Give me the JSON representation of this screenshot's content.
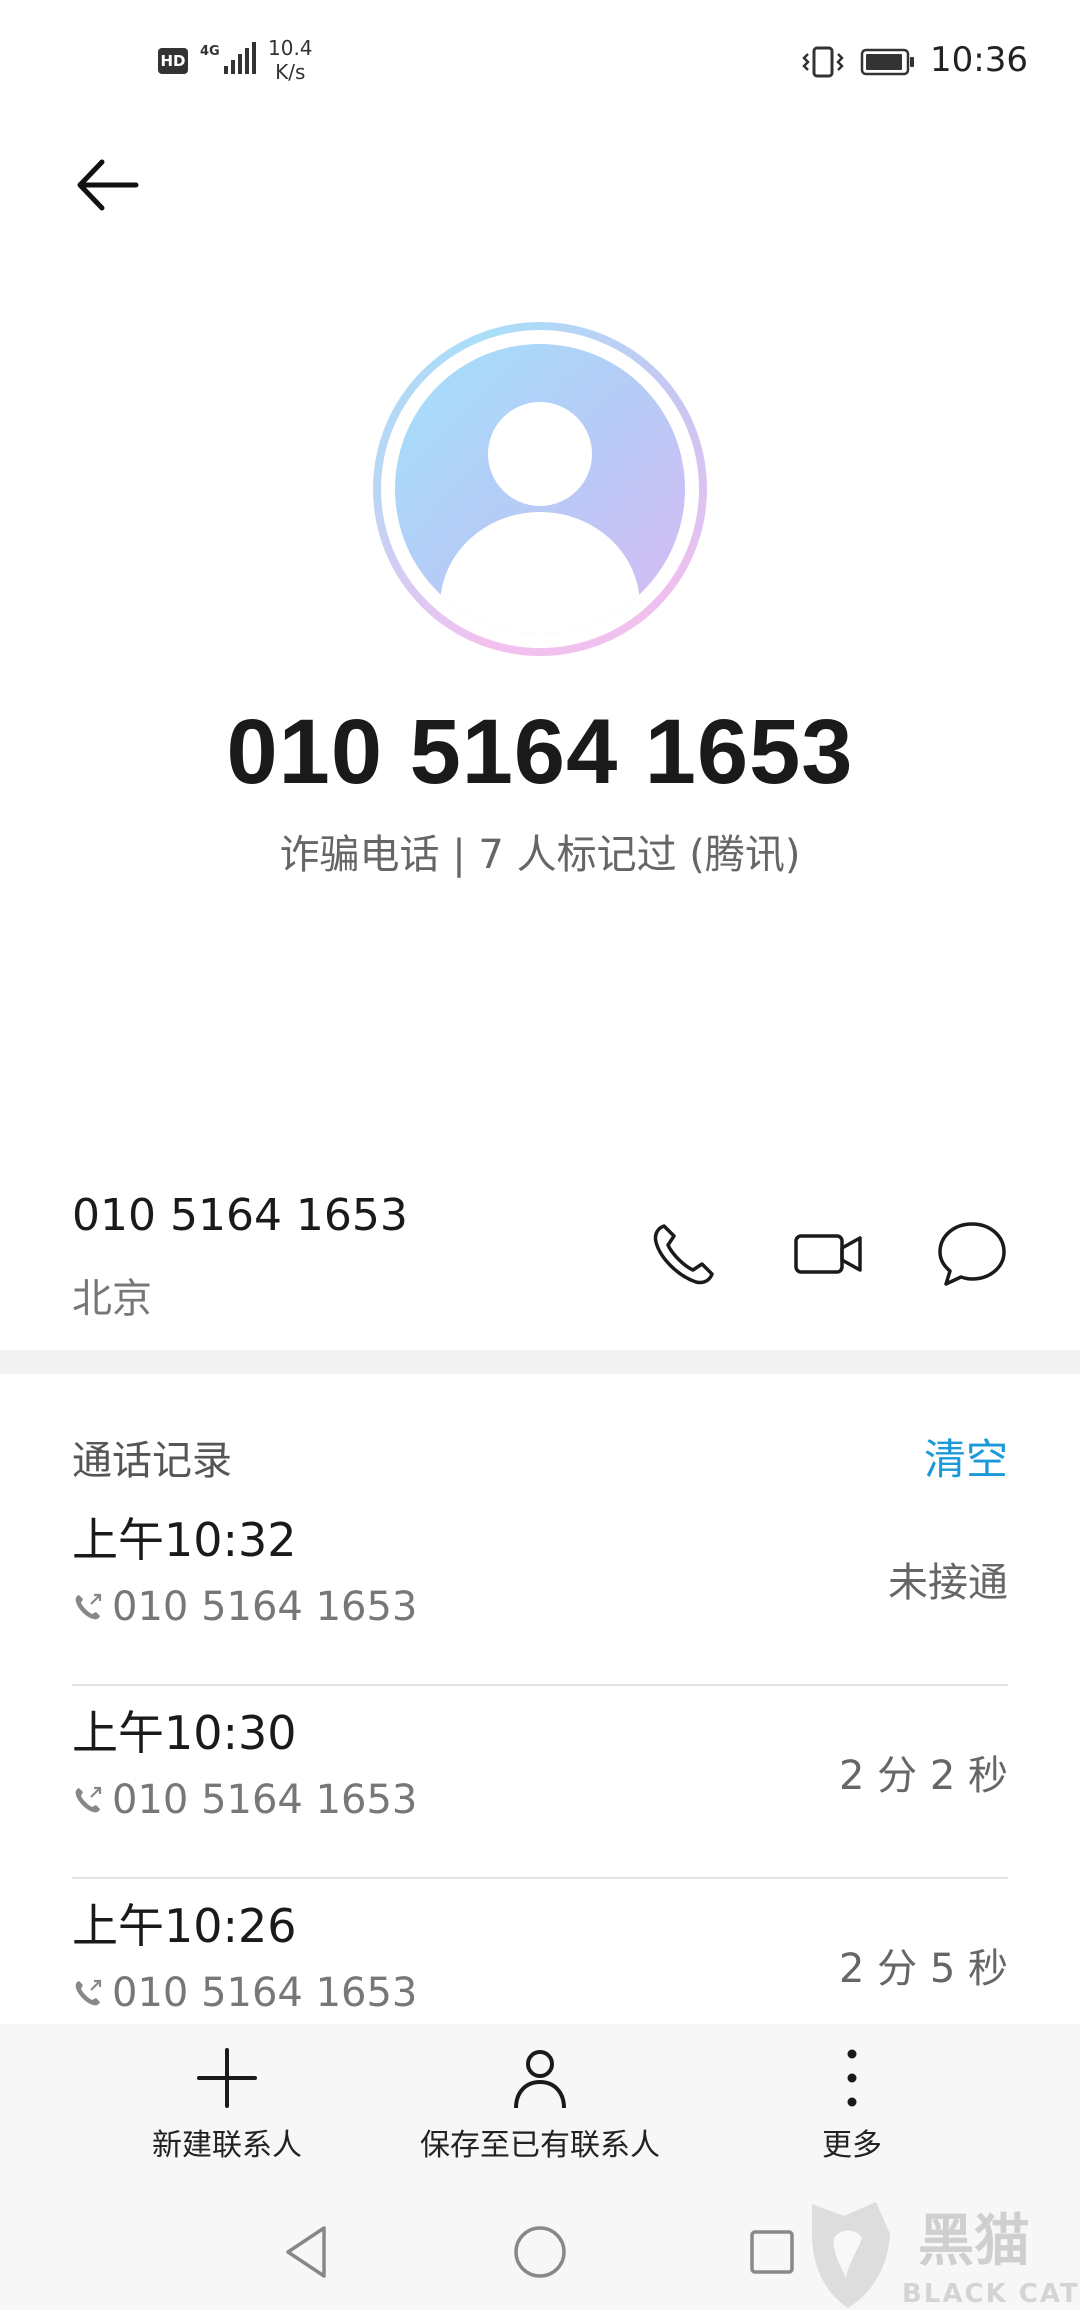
{
  "status_bar": {
    "hd": "HD",
    "network": "4G",
    "speed_value": "10.4",
    "speed_unit": "K/s",
    "time": "10:36"
  },
  "contact": {
    "number_display": "010 5164 1653",
    "tag": "诈骗电话 | 7 人标记过 (腾讯)",
    "number": "010 5164 1653",
    "location": "北京"
  },
  "call_log": {
    "title": "通话记录",
    "clear_label": "清空",
    "entries": [
      {
        "time": "上午10:32",
        "number": "010 5164 1653",
        "status": "未接通"
      },
      {
        "time": "上午10:30",
        "number": "010 5164 1653",
        "status": "2 分 2 秒"
      },
      {
        "time": "上午10:26",
        "number": "010 5164 1653",
        "status": "2 分 5 秒"
      }
    ]
  },
  "actions": {
    "new_contact": "新建联系人",
    "save_existing": "保存至已有联系人",
    "more": "更多"
  },
  "watermark": {
    "brand_cn": "黑猫",
    "brand_en": "BLACK CAT"
  },
  "colors": {
    "accent": "#1a9ad8"
  }
}
